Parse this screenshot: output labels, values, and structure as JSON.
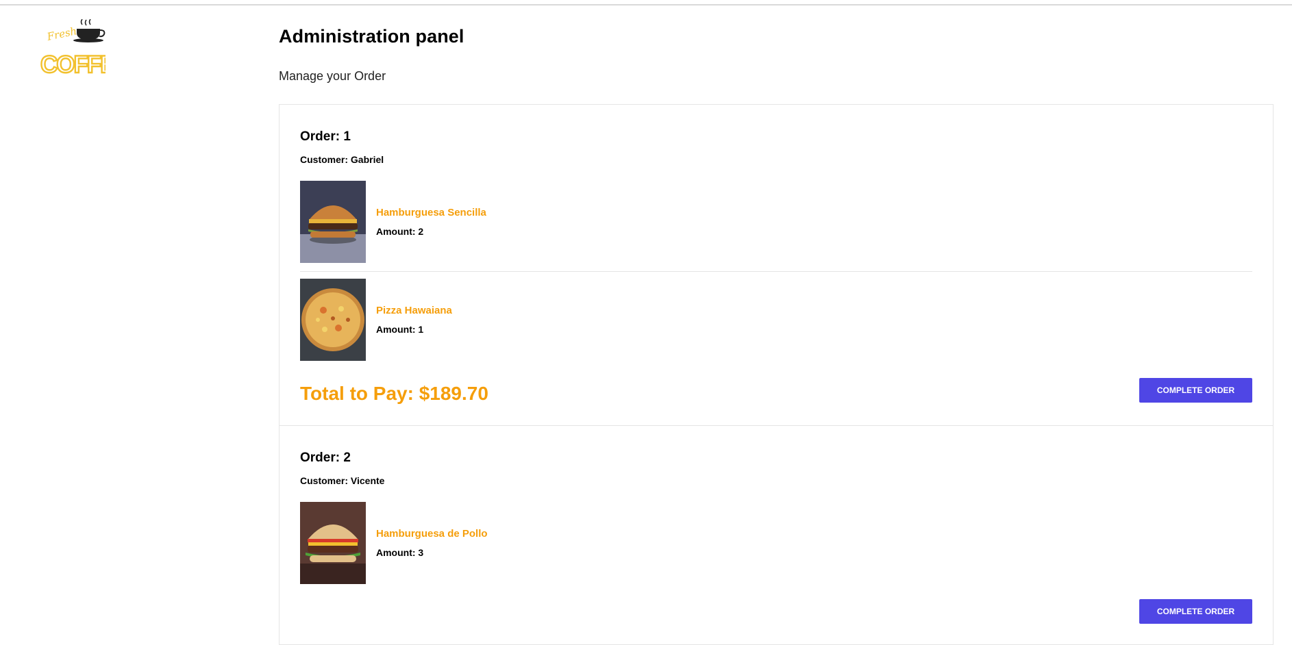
{
  "brand": {
    "logo_word": "COFFEE",
    "logo_script": "Fresh",
    "accent": "#f59e0b",
    "button_color": "#4f46e5",
    "logo_color": "#f2c12e"
  },
  "header": {
    "title": "Administration panel",
    "subtitle": "Manage your Order"
  },
  "orders": [
    {
      "label": "Order: 1",
      "customer": "Customer: Gabriel",
      "items": [
        {
          "name": "Hamburguesa Sencilla",
          "amount": "Amount: 2",
          "image_icon": "burger-photo"
        },
        {
          "name": "Pizza Hawaiana",
          "amount": "Amount: 1",
          "image_icon": "pizza-photo"
        }
      ],
      "total": "Total to Pay: $189.70",
      "button_label": "COMPLETE ORDER"
    },
    {
      "label": "Order: 2",
      "customer": "Customer: Vicente",
      "items": [
        {
          "name": "Hamburguesa de Pollo",
          "amount": "Amount: 3",
          "image_icon": "chicken-burger-photo"
        }
      ],
      "total": "",
      "button_label": "COMPLETE ORDER"
    }
  ]
}
